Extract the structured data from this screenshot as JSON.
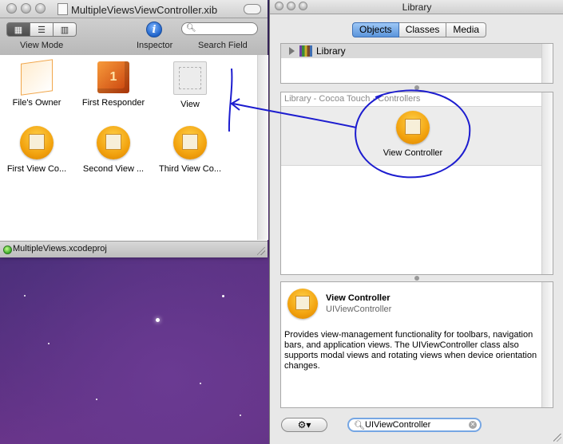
{
  "xib_window": {
    "title": "MultipleViewsViewController.xib",
    "toolbar": {
      "view_mode_label": "View Mode",
      "inspector_label": "Inspector",
      "inspector_glyph": "i",
      "search_label": "Search Field",
      "view_mode_options": [
        "icon-view",
        "list-view",
        "column-view"
      ],
      "view_mode_selected": "icon-view"
    },
    "objects": [
      {
        "label": "File's Owner",
        "icon": "files-owner-cube-icon"
      },
      {
        "label": "First Responder",
        "icon": "first-responder-cube-icon",
        "glyph": "1"
      },
      {
        "label": "View",
        "icon": "view-icon"
      },
      {
        "label": "First View Co...",
        "icon": "view-controller-icon"
      },
      {
        "label": "Second View ...",
        "icon": "view-controller-icon"
      },
      {
        "label": "Third View Co...",
        "icon": "view-controller-icon"
      }
    ]
  },
  "project_bar": {
    "label": "MultipleViews.xcodeproj"
  },
  "library": {
    "title": "Library",
    "tabs": [
      {
        "label": "Objects",
        "active": true
      },
      {
        "label": "Classes",
        "active": false
      },
      {
        "label": "Media",
        "active": false
      }
    ],
    "tree_root": "Library",
    "group_header": "Library - Cocoa Touch - Controllers",
    "item": {
      "label": "View Controller"
    },
    "detail": {
      "title": "View Controller",
      "class_name": "UIViewController",
      "description": "Provides view-management functionality for toolbars, navigation bars, and application views. The UIViewController class also supports modal views and rotating views when device orientation changes."
    },
    "search_value": "UIViewController",
    "gear_glyph": "⚙▾"
  },
  "colors": {
    "annotation_ink": "#1c1ccf",
    "selected_tab": "#5b95db"
  }
}
